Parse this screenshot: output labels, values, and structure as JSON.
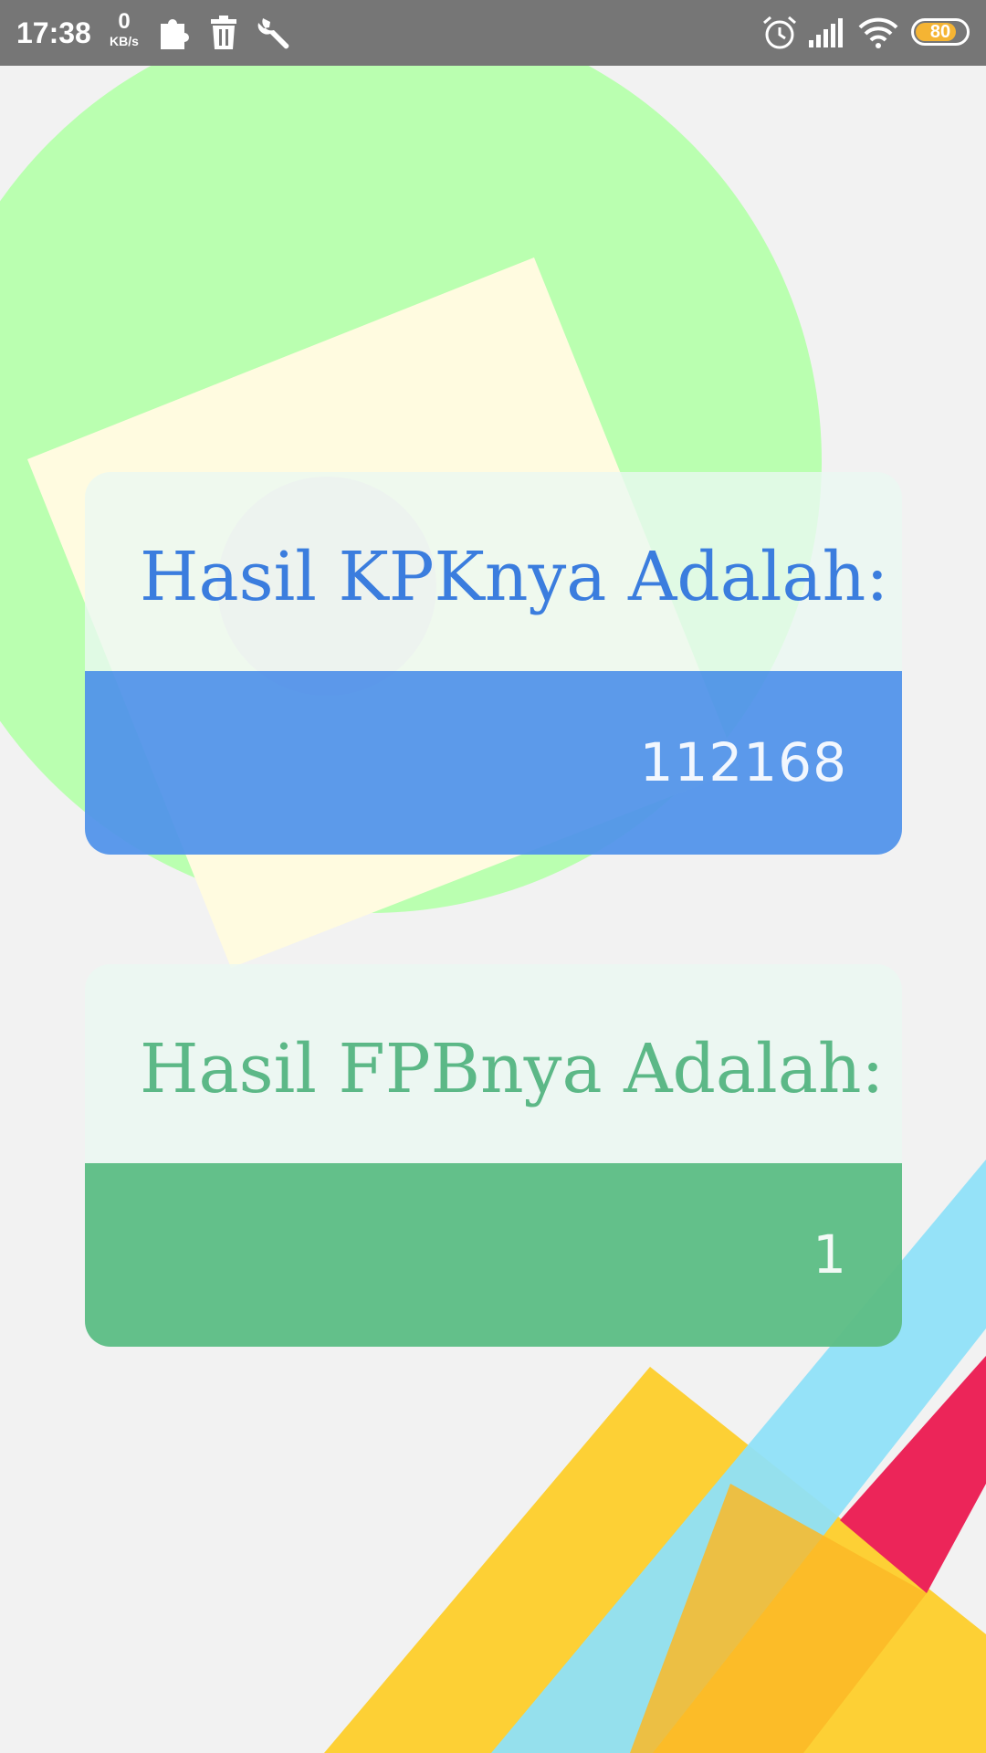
{
  "status_bar": {
    "time": "17:38",
    "net_speed_value": "0",
    "net_speed_unit": "KB/s",
    "battery_level": "80",
    "icons": [
      "puzzle-icon",
      "trash-icon",
      "wrench-icon",
      "alarm-icon",
      "signal-icon",
      "wifi-icon",
      "battery-icon"
    ]
  },
  "kpk_card": {
    "title": "Hasil KPKnya Adalah:",
    "value": "112168"
  },
  "fpb_card": {
    "title": "Hasil FPBnya Adalah:",
    "value": "1"
  },
  "colors": {
    "status_bar": "#767676",
    "kpk_accent": "#5092eb",
    "kpk_title": "#3b7dde",
    "fpb_accent": "#5ebe86",
    "fpb_title": "#5cb887",
    "background": "#f2f2f2"
  }
}
